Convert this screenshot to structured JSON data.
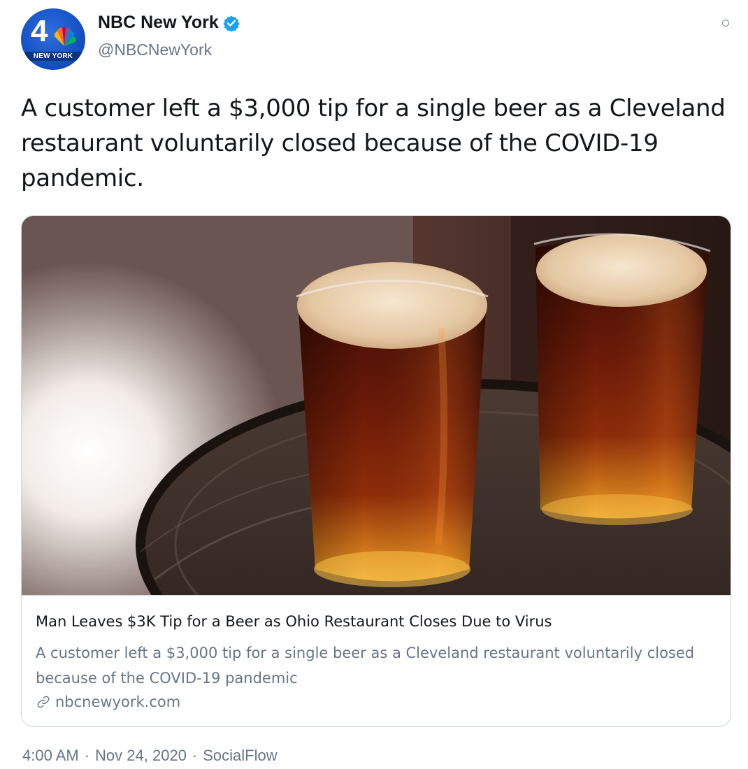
{
  "account": {
    "name": "NBC New York",
    "handle": "@NBCNewYork",
    "verified": true,
    "avatar_number": "4",
    "avatar_location": "NEW YORK",
    "avatar_icon": "nbc-peacock-icon"
  },
  "tweet": {
    "text": "A customer left a $3,000 tip for a single beer as a Cleveland restaurant voluntarily closed because of the COVID-19 pandemic."
  },
  "card": {
    "image_icon": "two-pints-of-beer-photo",
    "title": "Man Leaves $3K Tip for a Beer as Ohio Restaurant Closes Due to Virus",
    "description": "A customer left a $3,000 tip for a single beer as a Cleveland restaurant voluntarily closed because of the COVID-19 pandemic",
    "domain": "nbcnewyork.com",
    "link_icon": "link-icon"
  },
  "meta": {
    "time": "4:00 AM",
    "separator": "·",
    "date": "Nov 24, 2020",
    "source": "SocialFlow"
  },
  "colors": {
    "brand_blue": "#1551c4",
    "verified_blue": "#1da1f2",
    "secondary_text": "#657786",
    "border": "#ccd6dd"
  }
}
